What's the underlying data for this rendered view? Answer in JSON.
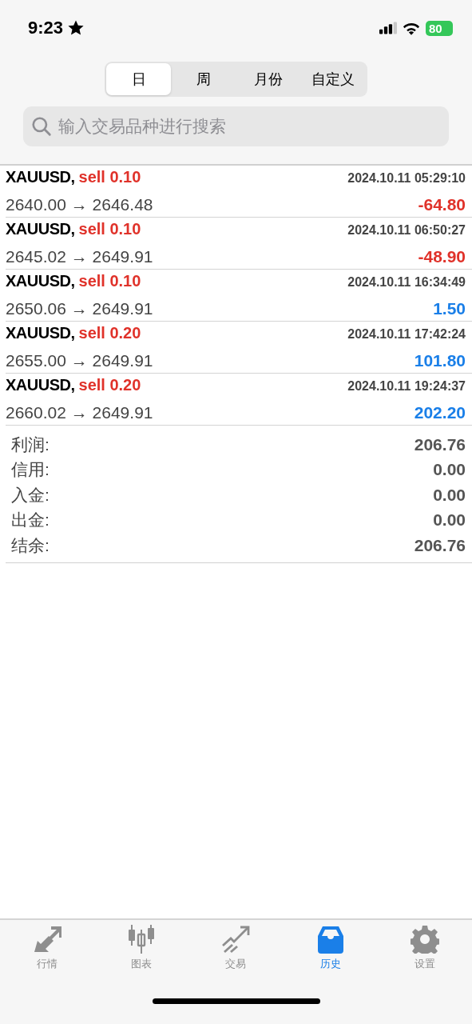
{
  "status_bar": {
    "time": "9:23",
    "battery": "80"
  },
  "period_tabs": [
    {
      "label": "日",
      "selected": true
    },
    {
      "label": "周",
      "selected": false
    },
    {
      "label": "月份",
      "selected": false
    },
    {
      "label": "自定义",
      "selected": false
    }
  ],
  "search": {
    "placeholder": "输入交易品种进行搜索"
  },
  "deals": [
    {
      "symbol": "XAUUSD,",
      "side": "sell 0.10",
      "time": "2024.10.11 05:29:10",
      "prices": "2640.00 → 2646.48",
      "profit": "-64.80",
      "color": "#e0322a"
    },
    {
      "symbol": "XAUUSD,",
      "side": "sell 0.10",
      "time": "2024.10.11 06:50:27",
      "prices": "2645.02 → 2649.91",
      "profit": "-48.90",
      "color": "#e0322a"
    },
    {
      "symbol": "XAUUSD,",
      "side": "sell 0.10",
      "time": "2024.10.11 16:34:49",
      "prices": "2650.06 → 2649.91",
      "profit": "1.50",
      "color": "#1a7fe8"
    },
    {
      "symbol": "XAUUSD,",
      "side": "sell 0.20",
      "time": "2024.10.11 17:42:24",
      "prices": "2655.00 → 2649.91",
      "profit": "101.80",
      "color": "#1a7fe8"
    },
    {
      "symbol": "XAUUSD,",
      "side": "sell 0.20",
      "time": "2024.10.11 19:24:37",
      "prices": "2660.02 → 2649.91",
      "profit": "202.20",
      "color": "#1a7fe8"
    }
  ],
  "summary": [
    {
      "label": "利润:",
      "value": "206.76"
    },
    {
      "label": "信用:",
      "value": "0.00"
    },
    {
      "label": "入金:",
      "value": "0.00"
    },
    {
      "label": "出金:",
      "value": "0.00"
    },
    {
      "label": "结余:",
      "value": "206.76"
    }
  ],
  "tab_bar": [
    {
      "label": "行情",
      "selected": false
    },
    {
      "label": "图表",
      "selected": false
    },
    {
      "label": "交易",
      "selected": false
    },
    {
      "label": "历史",
      "selected": true
    },
    {
      "label": "设置",
      "selected": false
    }
  ]
}
